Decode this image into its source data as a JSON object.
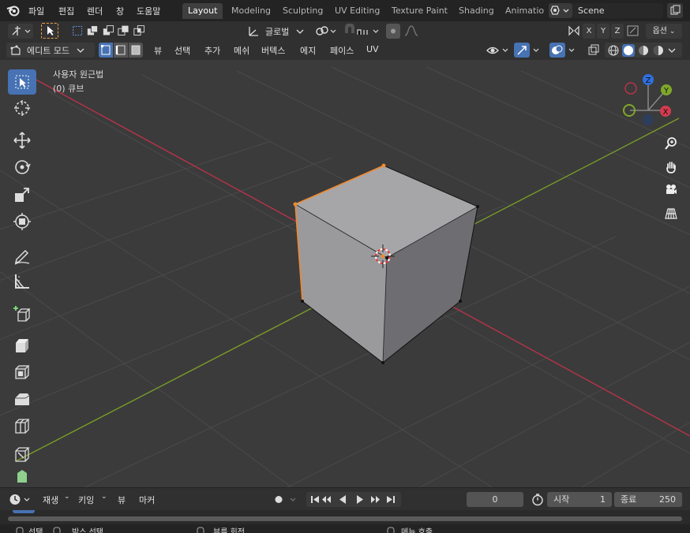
{
  "topbar": {
    "menus": [
      "파일",
      "편집",
      "렌더",
      "창",
      "도움말"
    ],
    "workspaces": [
      "Layout",
      "Modeling",
      "Sculpting",
      "UV Editing",
      "Texture Paint",
      "Shading",
      "Animatio"
    ],
    "active_workspace": "Layout",
    "scene_name": "Scene"
  },
  "header1": {
    "transform_orientation": "글로벌",
    "axes": [
      "X",
      "Y",
      "Z"
    ],
    "options_label": "옵션"
  },
  "header2": {
    "mode": "에디트 모드",
    "menus": [
      "뷰",
      "선택",
      "추가",
      "메쉬",
      "버텍스",
      "에지",
      "페이스",
      "UV"
    ]
  },
  "viewport": {
    "view_name": "사용자 원근법",
    "object_label": "(0) 큐브",
    "gizmo_axes": {
      "x": "X",
      "y": "Y",
      "z": "Z"
    },
    "colors": {
      "x_axis": "#b8334a",
      "y_axis": "#7a9a2a",
      "selected": "#f08a30",
      "active_tool": "#4772b3"
    }
  },
  "tools": [
    "select-box-tool",
    "cursor-tool",
    "move-tool",
    "rotate-tool",
    "scale-tool",
    "transform-tool",
    "annotate-tool",
    "measure-tool",
    "add-cube-tool",
    "extrude-tool",
    "inset-tool",
    "bevel-tool",
    "loop-cut-tool",
    "knife-tool",
    "poly-build-tool"
  ],
  "timeline": {
    "playback_label": "재생",
    "keying_label": "키잉",
    "view_label": "뷰",
    "marker_label": "마커",
    "current_frame": "0",
    "start_label": "시작",
    "start_value": "1",
    "end_label": "종료",
    "end_value": "250"
  },
  "statusbar": {
    "items": [
      "선택",
      "박스 선택",
      "뷰를 회전",
      "메뉴 호출"
    ]
  }
}
